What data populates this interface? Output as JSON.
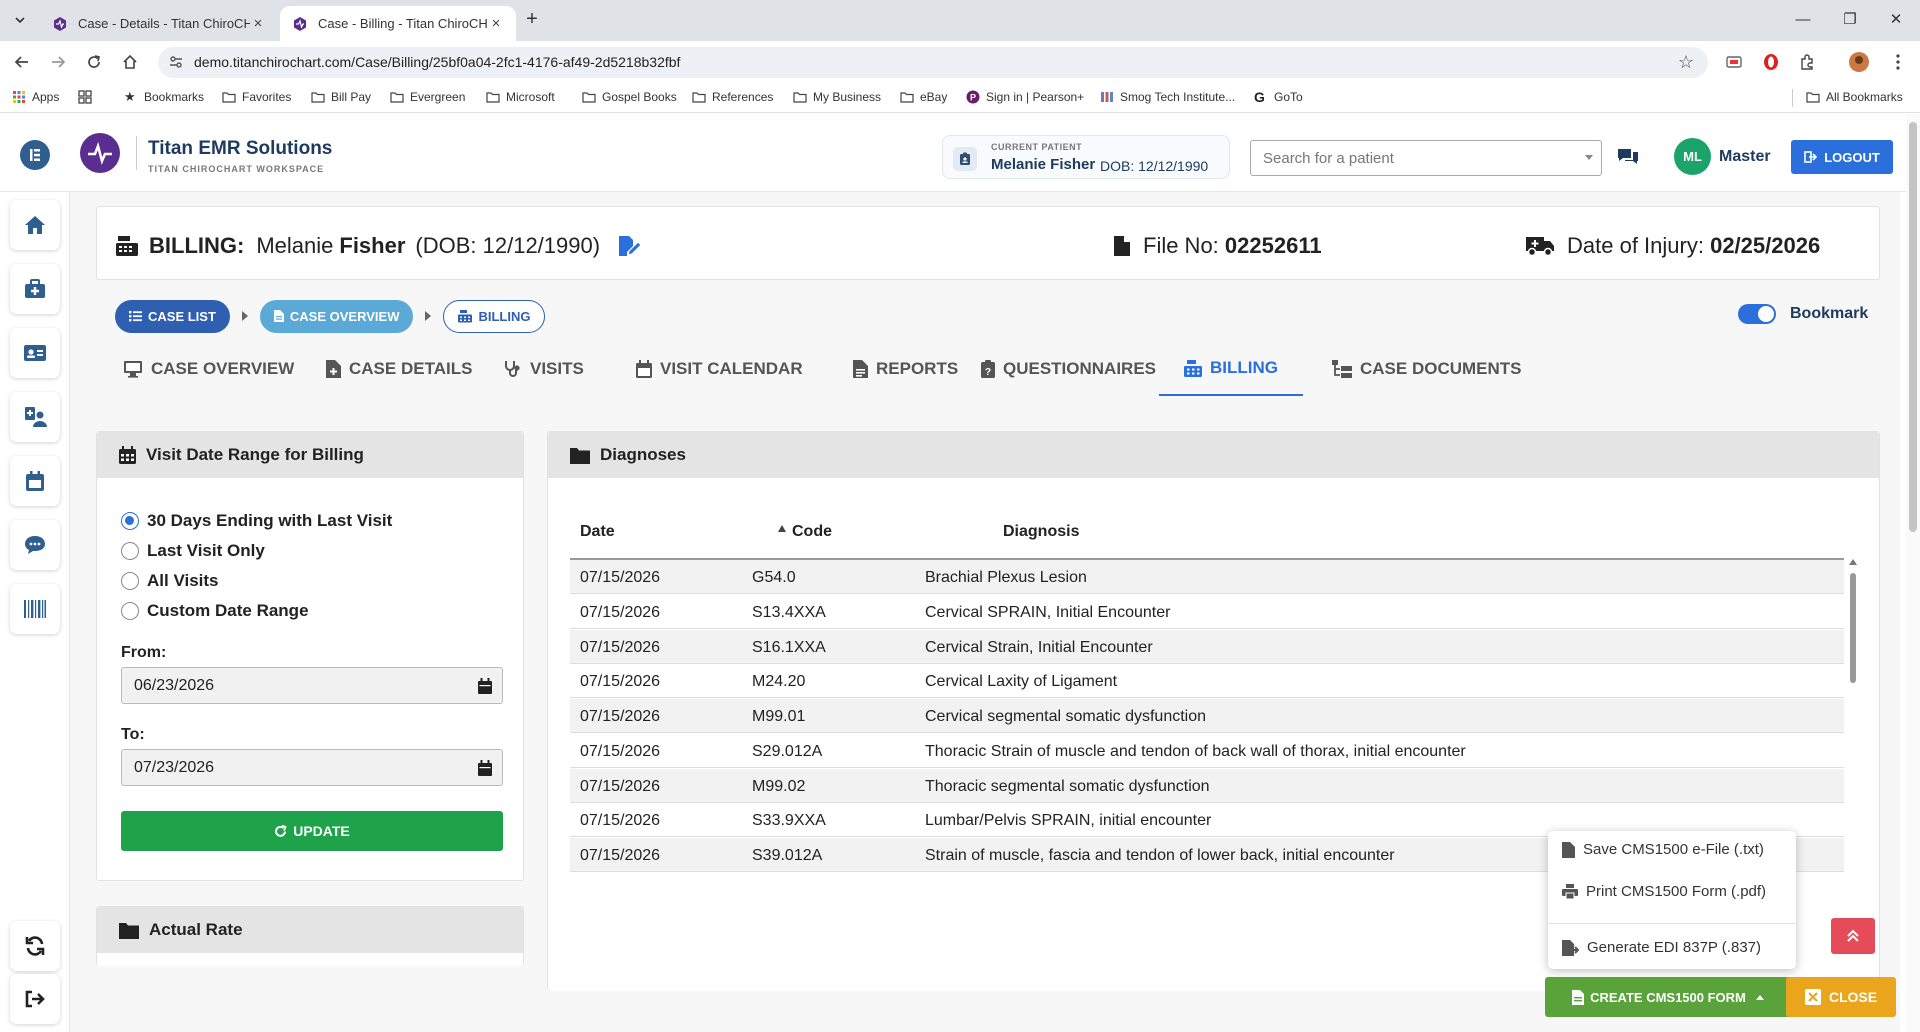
{
  "browser": {
    "tabs": [
      {
        "title": "Case - Details - Titan ChiroCHAR",
        "active": false
      },
      {
        "title": "Case - Billing - Titan ChiroCHAR",
        "active": true
      }
    ],
    "url": "demo.titanchirochart.com/Case/Billing/25bf0a04-2fc1-4176-af49-2d5218b32fbf",
    "bookmarks": [
      "Apps",
      "Bookmarks",
      "Favorites",
      "Bill Pay",
      "Evergreen",
      "Microsoft",
      "Gospel Books",
      "References",
      "My Business",
      "eBay",
      "Sign in | Pearson+",
      "Smog Tech Institute...",
      "GoTo"
    ],
    "all_bookmarks": "All Bookmarks"
  },
  "header": {
    "brand_title": "Titan EMR Solutions",
    "brand_subtitle": "TITAN CHIROCHART WORKSPACE",
    "current_patient_label": "CURRENT PATIENT",
    "current_patient_name": "Melanie Fisher",
    "current_patient_dob": "DOB: 12/12/1990",
    "search_placeholder": "Search for a patient",
    "user_initials": "ML",
    "user_name": "Master",
    "logout_label": "LOGOUT"
  },
  "billing_header": {
    "label": "BILLING:",
    "first_name": "Melanie",
    "last_name": "Fisher",
    "dob": "(DOB: 12/12/1990)",
    "file_label": "File No:",
    "file_no": "02252611",
    "injury_label": "Date of Injury:",
    "injury_date": "02/25/2026"
  },
  "breadcrumbs": [
    "CASE LIST",
    "CASE OVERVIEW",
    "BILLING"
  ],
  "bookmark_label": "Bookmark",
  "bookmark_on": true,
  "nav_tabs": [
    "CASE OVERVIEW",
    "CASE DETAILS",
    "VISITS",
    "VISIT CALENDAR",
    "REPORTS",
    "QUESTIONNAIRES",
    "BILLING",
    "CASE DOCUMENTS"
  ],
  "active_tab": "BILLING",
  "visit_range": {
    "title": "Visit Date Range for Billing",
    "options": [
      "30 Days Ending with Last Visit",
      "Last Visit Only",
      "All Visits",
      "Custom Date Range"
    ],
    "selected": "30 Days Ending with Last Visit",
    "from_label": "From:",
    "from_value": "06/23/2026",
    "to_label": "To:",
    "to_value": "07/23/2026",
    "update_label": "UPDATE"
  },
  "actual_rate_title": "Actual Rate",
  "diagnoses": {
    "title": "Diagnoses",
    "columns": [
      "Date",
      "Code",
      "Diagnosis"
    ],
    "rows": [
      [
        "07/15/2026",
        "G54.0",
        "Brachial Plexus Lesion"
      ],
      [
        "07/15/2026",
        "S13.4XXA",
        "Cervical SPRAIN, Initial Encounter"
      ],
      [
        "07/15/2026",
        "S16.1XXA",
        "Cervical Strain, Initial Encounter"
      ],
      [
        "07/15/2026",
        "M24.20",
        "Cervical Laxity of Ligament"
      ],
      [
        "07/15/2026",
        "M99.01",
        "Cervical segmental somatic dysfunction"
      ],
      [
        "07/15/2026",
        "S29.012A",
        "Thoracic Strain of muscle and tendon of back wall of thorax, initial encounter"
      ],
      [
        "07/15/2026",
        "M99.02",
        "Thoracic segmental somatic dysfunction"
      ],
      [
        "07/15/2026",
        "S33.9XXA",
        "Lumbar/Pelvis SPRAIN, initial encounter"
      ],
      [
        "07/15/2026",
        "S39.012A",
        "Strain of muscle, fascia and tendon of lower back, initial encounter"
      ]
    ]
  },
  "cms_menu": {
    "items": [
      "Save CMS1500 e-File (.txt)",
      "Print CMS1500 Form (.pdf)",
      "Generate EDI 837P (.837)"
    ],
    "button_label": "CREATE CMS1500 FORM"
  },
  "close_label": "CLOSE",
  "colors": {
    "primary": "#2a6fdb",
    "success": "#1ea34a",
    "cms": "#5aa23a",
    "warning": "#e9a51b",
    "danger": "#e64b5a"
  }
}
